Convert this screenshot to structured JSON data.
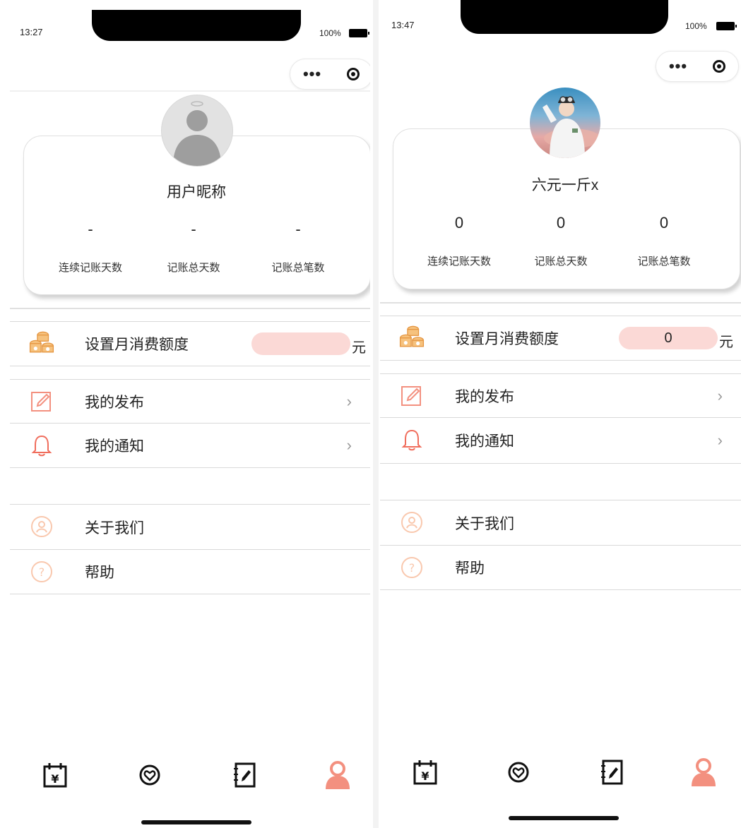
{
  "left": {
    "status": {
      "time": "13:27",
      "battery": "100%"
    },
    "profile": {
      "nickname": "用户昵称",
      "stats": [
        {
          "value": "-",
          "label": "连续记账天数"
        },
        {
          "value": "-",
          "label": "记账总天数"
        },
        {
          "value": "-",
          "label": "记账总笔数"
        }
      ]
    },
    "budget": {
      "label": "设置月消费额度",
      "value": "",
      "unit": "元"
    },
    "menu": [
      {
        "label": "我的发布"
      },
      {
        "label": "我的通知"
      },
      {
        "label": "关于我们"
      },
      {
        "label": "帮助"
      }
    ]
  },
  "right": {
    "status": {
      "time": "13:47",
      "battery": "100%"
    },
    "profile": {
      "nickname": "六元一斤x",
      "stats": [
        {
          "value": "0",
          "label": "连续记账天数"
        },
        {
          "value": "0",
          "label": "记账总天数"
        },
        {
          "value": "0",
          "label": "记账总笔数"
        }
      ]
    },
    "budget": {
      "label": "设置月消费额度",
      "value": "0",
      "unit": "元"
    },
    "menu": [
      {
        "label": "我的发布"
      },
      {
        "label": "我的通知"
      },
      {
        "label": "关于我们"
      },
      {
        "label": "帮助"
      }
    ]
  },
  "capsule": {
    "more_icon": "•••",
    "close_icon": "target-icon"
  },
  "chevron": "›",
  "tabs": [
    {
      "icon": "calendar-yen-icon"
    },
    {
      "icon": "heart-chat-icon"
    },
    {
      "icon": "note-edit-icon"
    },
    {
      "icon": "user-icon",
      "active": true
    }
  ],
  "colors": {
    "accent": "#f3907f",
    "budget_bg": "#fbd9d6",
    "coin": "#f0a050"
  }
}
